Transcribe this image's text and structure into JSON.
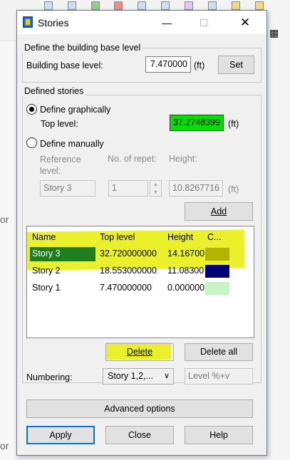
{
  "background": {
    "side_text_1": "or",
    "side_text_2": "or"
  },
  "dialog": {
    "title": "Stories",
    "close_glyph": "✕",
    "min_glyph": "—",
    "max_glyph": "☐"
  },
  "base_level": {
    "group_label": "Define the building base level",
    "label": "Building base level:",
    "value": "7.470000",
    "unit": "(ft)",
    "set_label": "Set"
  },
  "defined": {
    "group_label": "Defined stories",
    "graphically_label": "Define graphically",
    "top_level_label": "Top level:",
    "top_level_value": "37.2748399",
    "top_level_unit": "(ft)",
    "top_level_color": "#00e000",
    "manually_label": "Define manually",
    "reference_label": "Reference level:",
    "repeat_label": "No. of repet:",
    "height_label": "Height:",
    "reference_value": "Story 3",
    "repeat_value": "1",
    "height_value": "10.8267716",
    "height_unit": "(ft)",
    "add_label": "Add"
  },
  "table": {
    "headers": [
      "Name",
      "Top level",
      "Height",
      "C..."
    ],
    "rows": [
      {
        "name": "Story 3",
        "top": "32.720000000",
        "height": "14.16700",
        "color": "#b4b400"
      },
      {
        "name": "Story 2",
        "top": "18.553000000",
        "height": "11.08300",
        "color": "#00007a"
      },
      {
        "name": "Story 1",
        "top": "7.470000000",
        "height": "0.000000",
        "color": "#c8f5c8"
      }
    ]
  },
  "actions": {
    "delete_label": "Delete",
    "delete_all_label": "Delete all",
    "numbering_label": "Numbering:",
    "numbering_value": "Story 1,2,...",
    "level_placeholder": "Level %+v",
    "advanced_label": "Advanced options",
    "apply_label": "Apply",
    "close_label": "Close",
    "help_label": "Help"
  }
}
